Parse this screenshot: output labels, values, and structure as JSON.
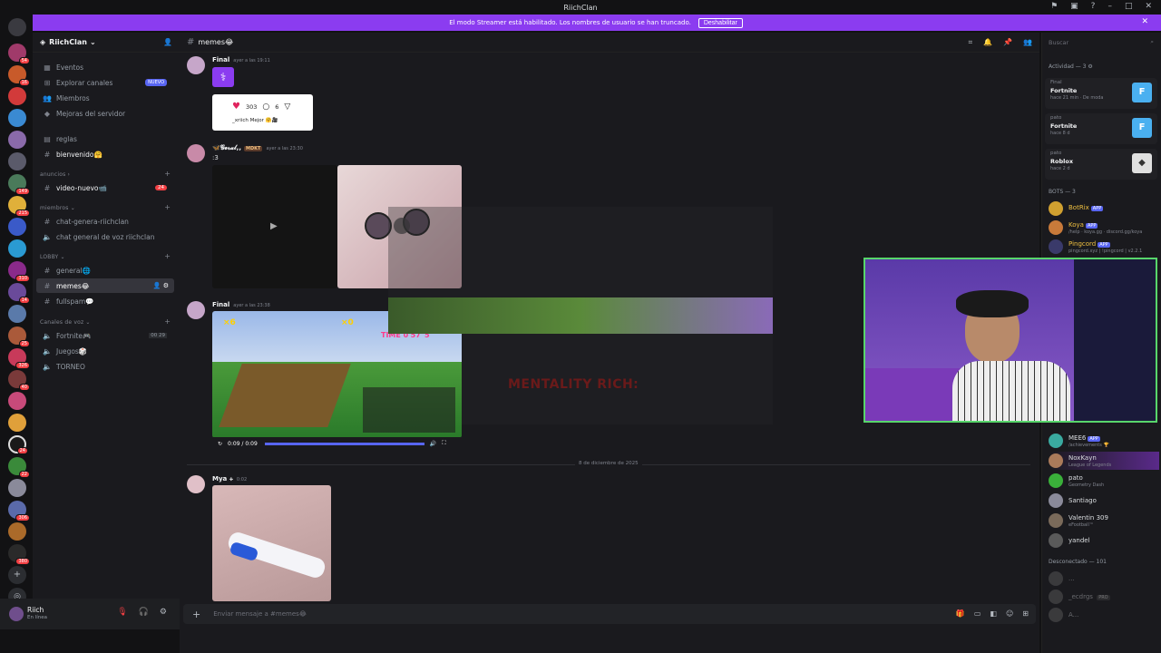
{
  "window": {
    "title": "RiichClan"
  },
  "streamer_banner": {
    "text": "El modo Streamer está habilitado. Los nombres de usuario se han truncado.",
    "button": "Deshabilitar"
  },
  "server": {
    "name": "RiichClan"
  },
  "nav_items": [
    {
      "label": "Eventos"
    },
    {
      "label": "Explorar canales",
      "badge": "NUEVO"
    },
    {
      "label": "Miembros"
    },
    {
      "label": "Mejoras del servidor"
    }
  ],
  "channels": {
    "reglas": "reglas",
    "bienvenido": "bienvenido🤗",
    "cat_anuncios": "anuncios",
    "video_nuevo": "video-nuevo📹",
    "video_nuevo_badge": "24",
    "cat_miembros": "miembros",
    "chat_genera": "chat-genera-riichclan",
    "chat_voz": "chat general de voz riichclan",
    "cat_lobby": "LOBBY",
    "general": "general🌐",
    "memes": "memes😂",
    "fullspam": "fullspam💬",
    "cat_voz": "Canales de voz",
    "fortnite": "Fortnite🎮",
    "fortnite_count_a": "00",
    "fortnite_count_b": "29",
    "juegos": "Juegos🎲",
    "torneo": "TORNEO"
  },
  "guild_badges": [
    "54",
    "16",
    "149",
    "215",
    "310",
    "14",
    "25",
    "326",
    "40",
    "24",
    "22",
    "306",
    "380"
  ],
  "user": {
    "name": "Riich",
    "status": "En línea"
  },
  "chat": {
    "channel": "memes😂",
    "messages": [
      {
        "author": "Final",
        "time": "ayer a las 19:11",
        "embed_likes": "303",
        "embed_comments": "6",
        "embed_caption": "_xriich Mejor 🤗🎥"
      },
      {
        "author": "🦋𝓖𝓮𝓻𝓪𝓵,,",
        "tag": "MDKT",
        "time": "ayer a las 23:30",
        "text": ":3"
      },
      {
        "author": "Final",
        "time": "ayer a las 23:38",
        "video_time": "0:09 / 0:09",
        "hud_left": "×6",
        "hud_mid": "×0",
        "hud_right": "×1",
        "game_text": "TIME 0'57\"5"
      },
      {
        "author": "Mya 🕂",
        "time": "0:02"
      }
    ],
    "date_divider": "8 de diciembre de 2025",
    "overlay_text": "MENTALITY RICH:",
    "composer_placeholder": "Enviar mensaje a #memes😂"
  },
  "members": {
    "search_placeholder": "Buscar",
    "activity_header": "Actividad — 3",
    "activities": [
      {
        "name": "Final",
        "game": "Fortnite",
        "time": "hace 21 min",
        "extra": "De moda"
      },
      {
        "name": "pato",
        "game": "Fortnite",
        "time": "hace 8 d"
      },
      {
        "name": "pato",
        "game": "Roblox",
        "time": "hace 2 d"
      }
    ],
    "bots_header": "BOTS — 3",
    "bots": [
      {
        "name": "BotRix",
        "app": "APP",
        "status": ""
      },
      {
        "name": "Koya",
        "app": "APP",
        "status": "/help · koya.gg · discord.gg/koya"
      },
      {
        "name": "Pingcord",
        "app": "APP",
        "status": "pingcord.xyz | !pingcord | v2.2.1"
      }
    ],
    "online": [
      {
        "name": "MEE6",
        "app": "APP",
        "status": "/achievements 🏆"
      },
      {
        "name": "NoxKayn",
        "status": "League of Legends"
      },
      {
        "name": "pato",
        "status": "Geometry Dash"
      },
      {
        "name": "Santiago",
        "status": ""
      },
      {
        "name": "Valentin 309",
        "status": "eFootball™"
      },
      {
        "name": "yandel",
        "status": ""
      }
    ],
    "offline_header": "Desconectado — 101",
    "offline": [
      {
        "name": "..."
      },
      {
        "name": "_ecdrgs",
        "tag": "PRO"
      },
      {
        "name": "A..."
      }
    ]
  },
  "colors": {
    "accent": "#8b3cf0",
    "webcam_border": "#58d66b",
    "mention": "#f23f43",
    "blurple": "#5865f2"
  }
}
